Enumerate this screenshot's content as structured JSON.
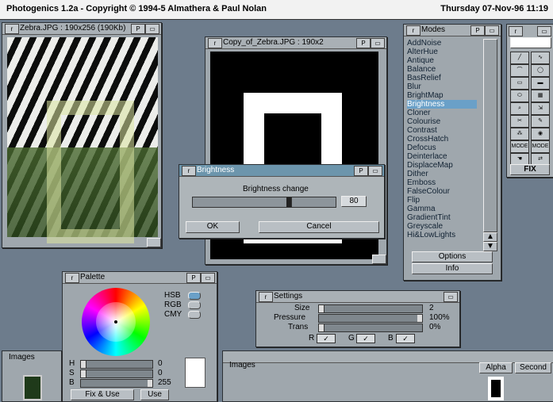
{
  "screen": {
    "title": "Photogenics 1.2a - Copyright © 1994-5 Almathera & Paul Nolan",
    "datetime": "Thursday 07-Nov-96 11:19"
  },
  "zebra_window": {
    "title": "Zebra.JPG : 190x256 (190Kb)"
  },
  "copy_window": {
    "title": "Copy_of_Zebra.JPG : 190x2"
  },
  "modes": {
    "title": "Modes",
    "items": [
      "AddNoise",
      "AlterHue",
      "Antique",
      "Balance",
      "BasRelief",
      "Blur",
      "BrightMap",
      "Brightness",
      "Cloner",
      "Colourise",
      "Contrast",
      "CrossHatch",
      "Defocus",
      "Deinterlace",
      "DisplaceMap",
      "Dither",
      "Emboss",
      "FalseColour",
      "Flip",
      "Gamma",
      "GradientTint",
      "Greyscale",
      "Hi&LowLights"
    ],
    "selected_index": 7,
    "options_label": "Options",
    "info_label": "Info"
  },
  "tools": {
    "labels": [
      "MODE",
      "MODE",
      "FIX"
    ]
  },
  "brightness": {
    "title": "Brightness",
    "label": "Brightness change",
    "value": "80",
    "ok_label": "OK",
    "cancel_label": "Cancel"
  },
  "palette": {
    "title": "Palette",
    "modes": [
      "HSB",
      "RGB",
      "CMY"
    ],
    "h_label": "H",
    "s_label": "S",
    "b_label": "B",
    "h_value": "0",
    "s_value": "0",
    "b_value": "255",
    "fix_use_label": "Fix & Use",
    "use_label": "Use"
  },
  "settings": {
    "title": "Settings",
    "size_label": "Size",
    "size_value": "2",
    "pressure_label": "Pressure",
    "pressure_value": "100%",
    "trans_label": "Trans",
    "trans_value": "0%",
    "r_label": "R",
    "g_label": "G",
    "b_label": "B"
  },
  "images_left": {
    "title": "Images"
  },
  "images_bottom": {
    "title": "Images",
    "alpha_label": "Alpha",
    "second_label": "Second"
  }
}
